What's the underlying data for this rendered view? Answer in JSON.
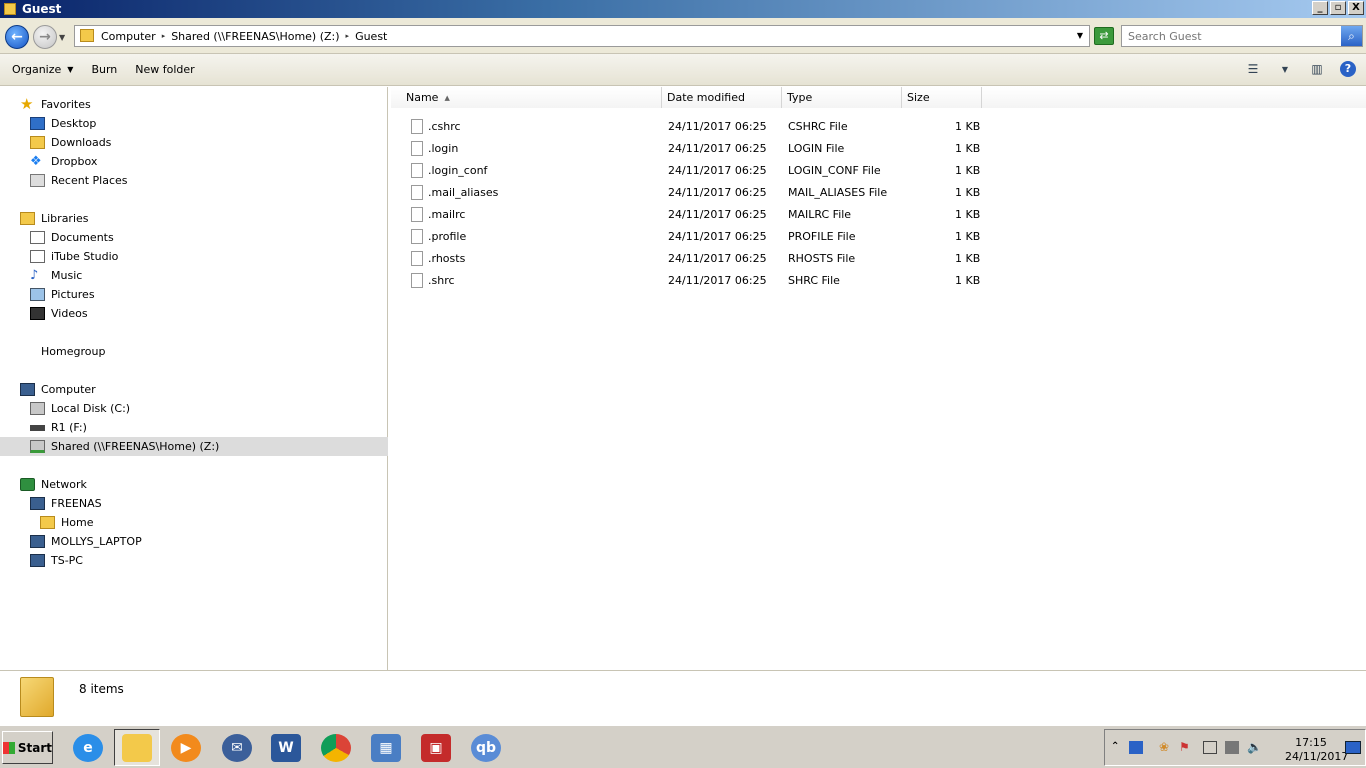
{
  "window": {
    "title": "Guest",
    "buttons": [
      "_",
      "▫",
      "X"
    ]
  },
  "address": {
    "crumbs": [
      "Computer",
      "Shared (\\\\FREENAS\\Home) (Z:)",
      "Guest"
    ],
    "search_placeholder": "Search Guest"
  },
  "toolbar": {
    "organize": "Organize",
    "burn": "Burn",
    "new_folder": "New folder"
  },
  "nav": {
    "favorites": "Favorites",
    "desktop": "Desktop",
    "downloads": "Downloads",
    "dropbox": "Dropbox",
    "recent": "Recent Places",
    "libraries": "Libraries",
    "documents": "Documents",
    "itube": "iTube Studio",
    "music": "Music",
    "pictures": "Pictures",
    "videos": "Videos",
    "homegroup": "Homegroup",
    "computer": "Computer",
    "local_disk": "Local Disk (C:)",
    "r1": "R1 (F:)",
    "shared": "Shared (\\\\FREENAS\\Home) (Z:)",
    "network": "Network",
    "freenas": "FREENAS",
    "home": "Home",
    "mollys": "MOLLYS_LAPTOP",
    "tspc": "TS-PC"
  },
  "columns": {
    "name": "Name",
    "date": "Date modified",
    "type": "Type",
    "size": "Size"
  },
  "files": [
    {
      "name": ".cshrc",
      "date": "24/11/2017 06:25",
      "type": "CSHRC File",
      "size": "1 KB"
    },
    {
      "name": ".login",
      "date": "24/11/2017 06:25",
      "type": "LOGIN File",
      "size": "1 KB"
    },
    {
      "name": ".login_conf",
      "date": "24/11/2017 06:25",
      "type": "LOGIN_CONF File",
      "size": "1 KB"
    },
    {
      "name": ".mail_aliases",
      "date": "24/11/2017 06:25",
      "type": "MAIL_ALIASES File",
      "size": "1 KB"
    },
    {
      "name": ".mailrc",
      "date": "24/11/2017 06:25",
      "type": "MAILRC File",
      "size": "1 KB"
    },
    {
      "name": ".profile",
      "date": "24/11/2017 06:25",
      "type": "PROFILE File",
      "size": "1 KB"
    },
    {
      "name": ".rhosts",
      "date": "24/11/2017 06:25",
      "type": "RHOSTS File",
      "size": "1 KB"
    },
    {
      "name": ".shrc",
      "date": "24/11/2017 06:25",
      "type": "SHRC File",
      "size": "1 KB"
    }
  ],
  "status": {
    "count": "8 items"
  },
  "taskbar": {
    "start": "Start",
    "time": "17:15",
    "date": "24/11/2017",
    "qb": "qb",
    "word": "W"
  }
}
